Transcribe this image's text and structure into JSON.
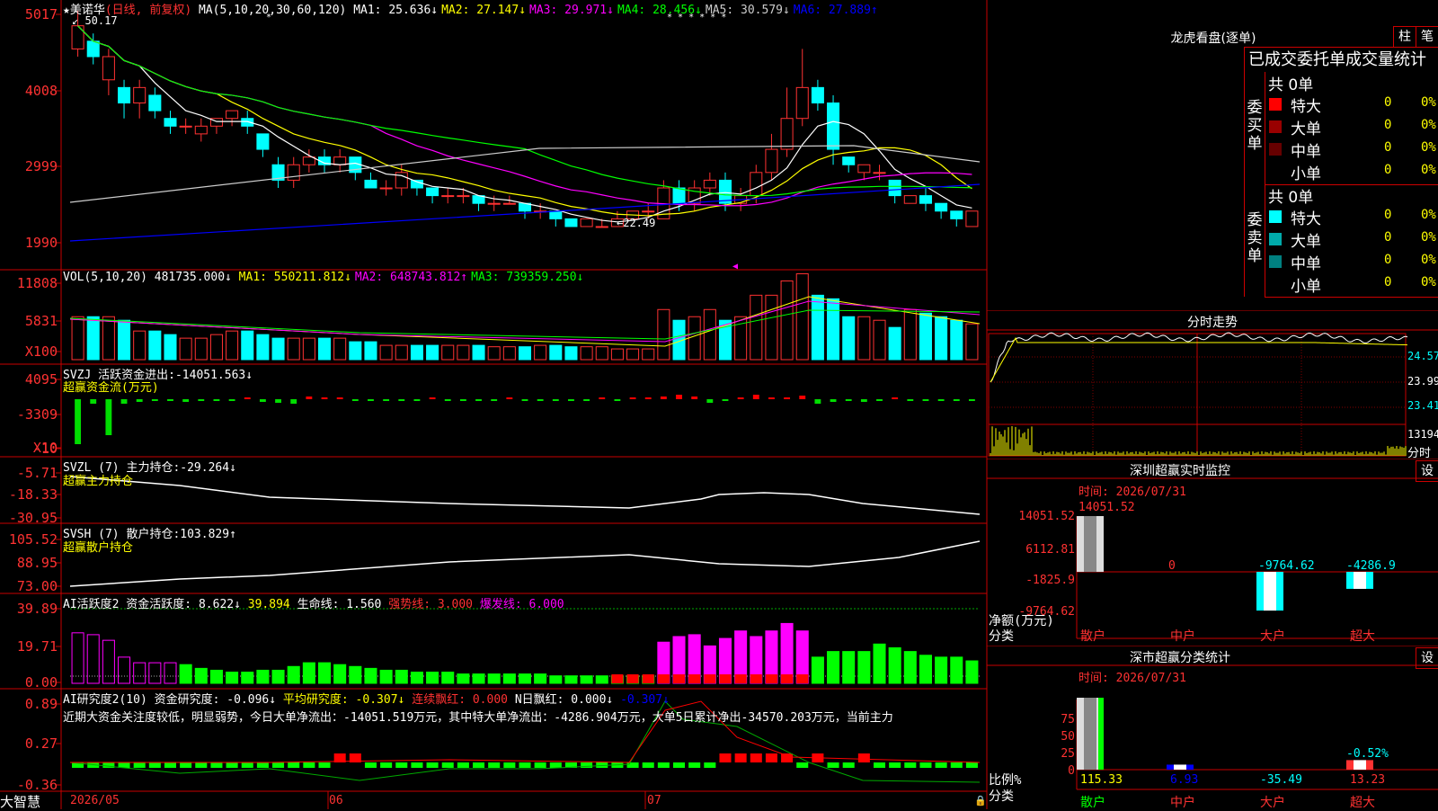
{
  "main": {
    "stock_name": "美诺华",
    "bar_type": "(日线, 前复权)",
    "ma_label": "MA(5,10,20,30,60,120)",
    "ma": [
      {
        "name": "MA1:",
        "value": "25.636↓",
        "color": "#ffffff"
      },
      {
        "name": "MA2:",
        "value": "27.147↓",
        "color": "#ffff00"
      },
      {
        "name": "MA3:",
        "value": "29.971↓",
        "color": "#ff00ff"
      },
      {
        "name": "MA4:",
        "value": "28.456↓",
        "color": "#00ff00"
      },
      {
        "name": "MA5:",
        "value": "30.579↓",
        "color": "#cccccc"
      },
      {
        "name": "MA6:",
        "value": "27.889↑",
        "color": "#0000ff"
      }
    ],
    "high_label": "50.17",
    "low_label": "22.49",
    "y_ticks": [
      "5017",
      "4008",
      "2999",
      "1990"
    ]
  },
  "vol": {
    "label": "VOL(5,10,20)",
    "value": "481735.000↓",
    "ma": [
      {
        "name": "MA1:",
        "value": "550211.812↓",
        "color": "#ffff00"
      },
      {
        "name": "MA2:",
        "value": "648743.812↑",
        "color": "#ff00ff"
      },
      {
        "name": "MA3:",
        "value": "739359.250↓",
        "color": "#00ff00"
      }
    ],
    "y_ticks": [
      "11808",
      "5831"
    ],
    "unit": "X100"
  },
  "svzj": {
    "label": "SVZJ  活跃资金进出:",
    "value": "-14051.563↓",
    "sub": "超赢资金流(万元)",
    "y_ticks": [
      "4095",
      "-3309",
      "-10"
    ],
    "unit": "X10"
  },
  "svzl": {
    "label": "SVZL (7) 主力持仓:",
    "value": "-29.264↓",
    "sub": "超赢主力持仓",
    "y_ticks": [
      "-5.71",
      "-18.33",
      "-30.95"
    ]
  },
  "svsh": {
    "label": "SVSH (7) 散户持仓:",
    "value": "103.829↑",
    "sub": "超赢散户持仓",
    "y_ticks": [
      "105.52",
      "88.95",
      "73.00"
    ]
  },
  "ai1": {
    "label": "AI活跃度2 资金活跃度:",
    "v1": "8.622↓",
    "v2": "39.894",
    "v3": "生命线: 1.560",
    "v4": "强势线: 3.000",
    "v5": "爆发线: 6.000",
    "y_ticks": [
      "39.89",
      "19.71",
      "0.00"
    ]
  },
  "ai2": {
    "label": "AI研究度2(10) 资金研究度:",
    "v1": "-0.096↓",
    "v2": "平均研究度: -0.307↓",
    "v3": "连续飘红: 0.000",
    "v4": "N日飘红: 0.000↓",
    "v5": "-0.307↓",
    "text": "近期大资金关注度较低，明显弱势，今日大单净流出：-14051.519万元，其中特大单净流出：-4286.904万元，大单5日累计净出-34570.203万元，当前主力",
    "y_ticks": [
      "0.89",
      "0.27",
      "-0.36"
    ]
  },
  "bottom": {
    "brand": "大智慧",
    "dates": [
      "2026/05",
      "06",
      "07"
    ]
  },
  "dragon": {
    "title": "龙虎看盘(逐单)",
    "btn1": "柱",
    "btn2": "笔",
    "subtitle": "已成交委托单成交量统计",
    "buy": {
      "label": "委买单",
      "total": "共 0单",
      "rows": [
        {
          "name": "特大",
          "v": "0",
          "p": "0%",
          "color": "#ff0000"
        },
        {
          "name": "大单",
          "v": "0",
          "p": "0%",
          "color": "#990000"
        },
        {
          "name": "中单",
          "v": "0",
          "p": "0%",
          "color": "#660000"
        },
        {
          "name": "小单",
          "v": "0",
          "p": "0%",
          "color": "#000000"
        }
      ]
    },
    "sell": {
      "label": "委卖单",
      "total": "共 0单",
      "rows": [
        {
          "name": "特大",
          "v": "0",
          "p": "0%",
          "color": "#00ffff"
        },
        {
          "name": "大单",
          "v": "0",
          "p": "0%",
          "color": "#00aaaa"
        },
        {
          "name": "中单",
          "v": "0",
          "p": "0%",
          "color": "#008080"
        },
        {
          "name": "小单",
          "v": "0",
          "p": "0%",
          "color": "#000000"
        }
      ]
    }
  },
  "intraday": {
    "title": "分时走势",
    "y_labels": [
      "24.57",
      "23.99",
      "23.41"
    ],
    "vol_label": "13194",
    "bottom_label": "分时"
  },
  "monitor": {
    "title": "深圳超赢实时监控",
    "btn": "设",
    "time": "时间: 2026/07/31",
    "y_ticks": [
      "14051.52",
      "6112.81",
      "-1825.9",
      "-9764.62"
    ],
    "bar_labels": [
      "14051.52",
      "0",
      "-9764.62",
      "-4286.9"
    ],
    "y_unit": "净额(万元)",
    "x_unit": "分类",
    "cats": [
      "散户",
      "中户",
      "大户",
      "超大"
    ]
  },
  "classify": {
    "title": "深市超赢分类统计",
    "btn": "设",
    "time": "时间: 2026/07/31",
    "y_ticks": [
      "75",
      "50",
      "25",
      "0"
    ],
    "top_label": "-0.52%",
    "values": [
      "115.33",
      "6.93",
      "-35.49",
      "13.23"
    ],
    "y_unit": "比例%",
    "x_unit": "分类",
    "cats": [
      "散户",
      "中户",
      "大户",
      "超大"
    ]
  },
  "colors": {
    "up": "#ff3232",
    "down": "#00ffff",
    "frame": "#c80000",
    "grid": "#800000"
  }
}
